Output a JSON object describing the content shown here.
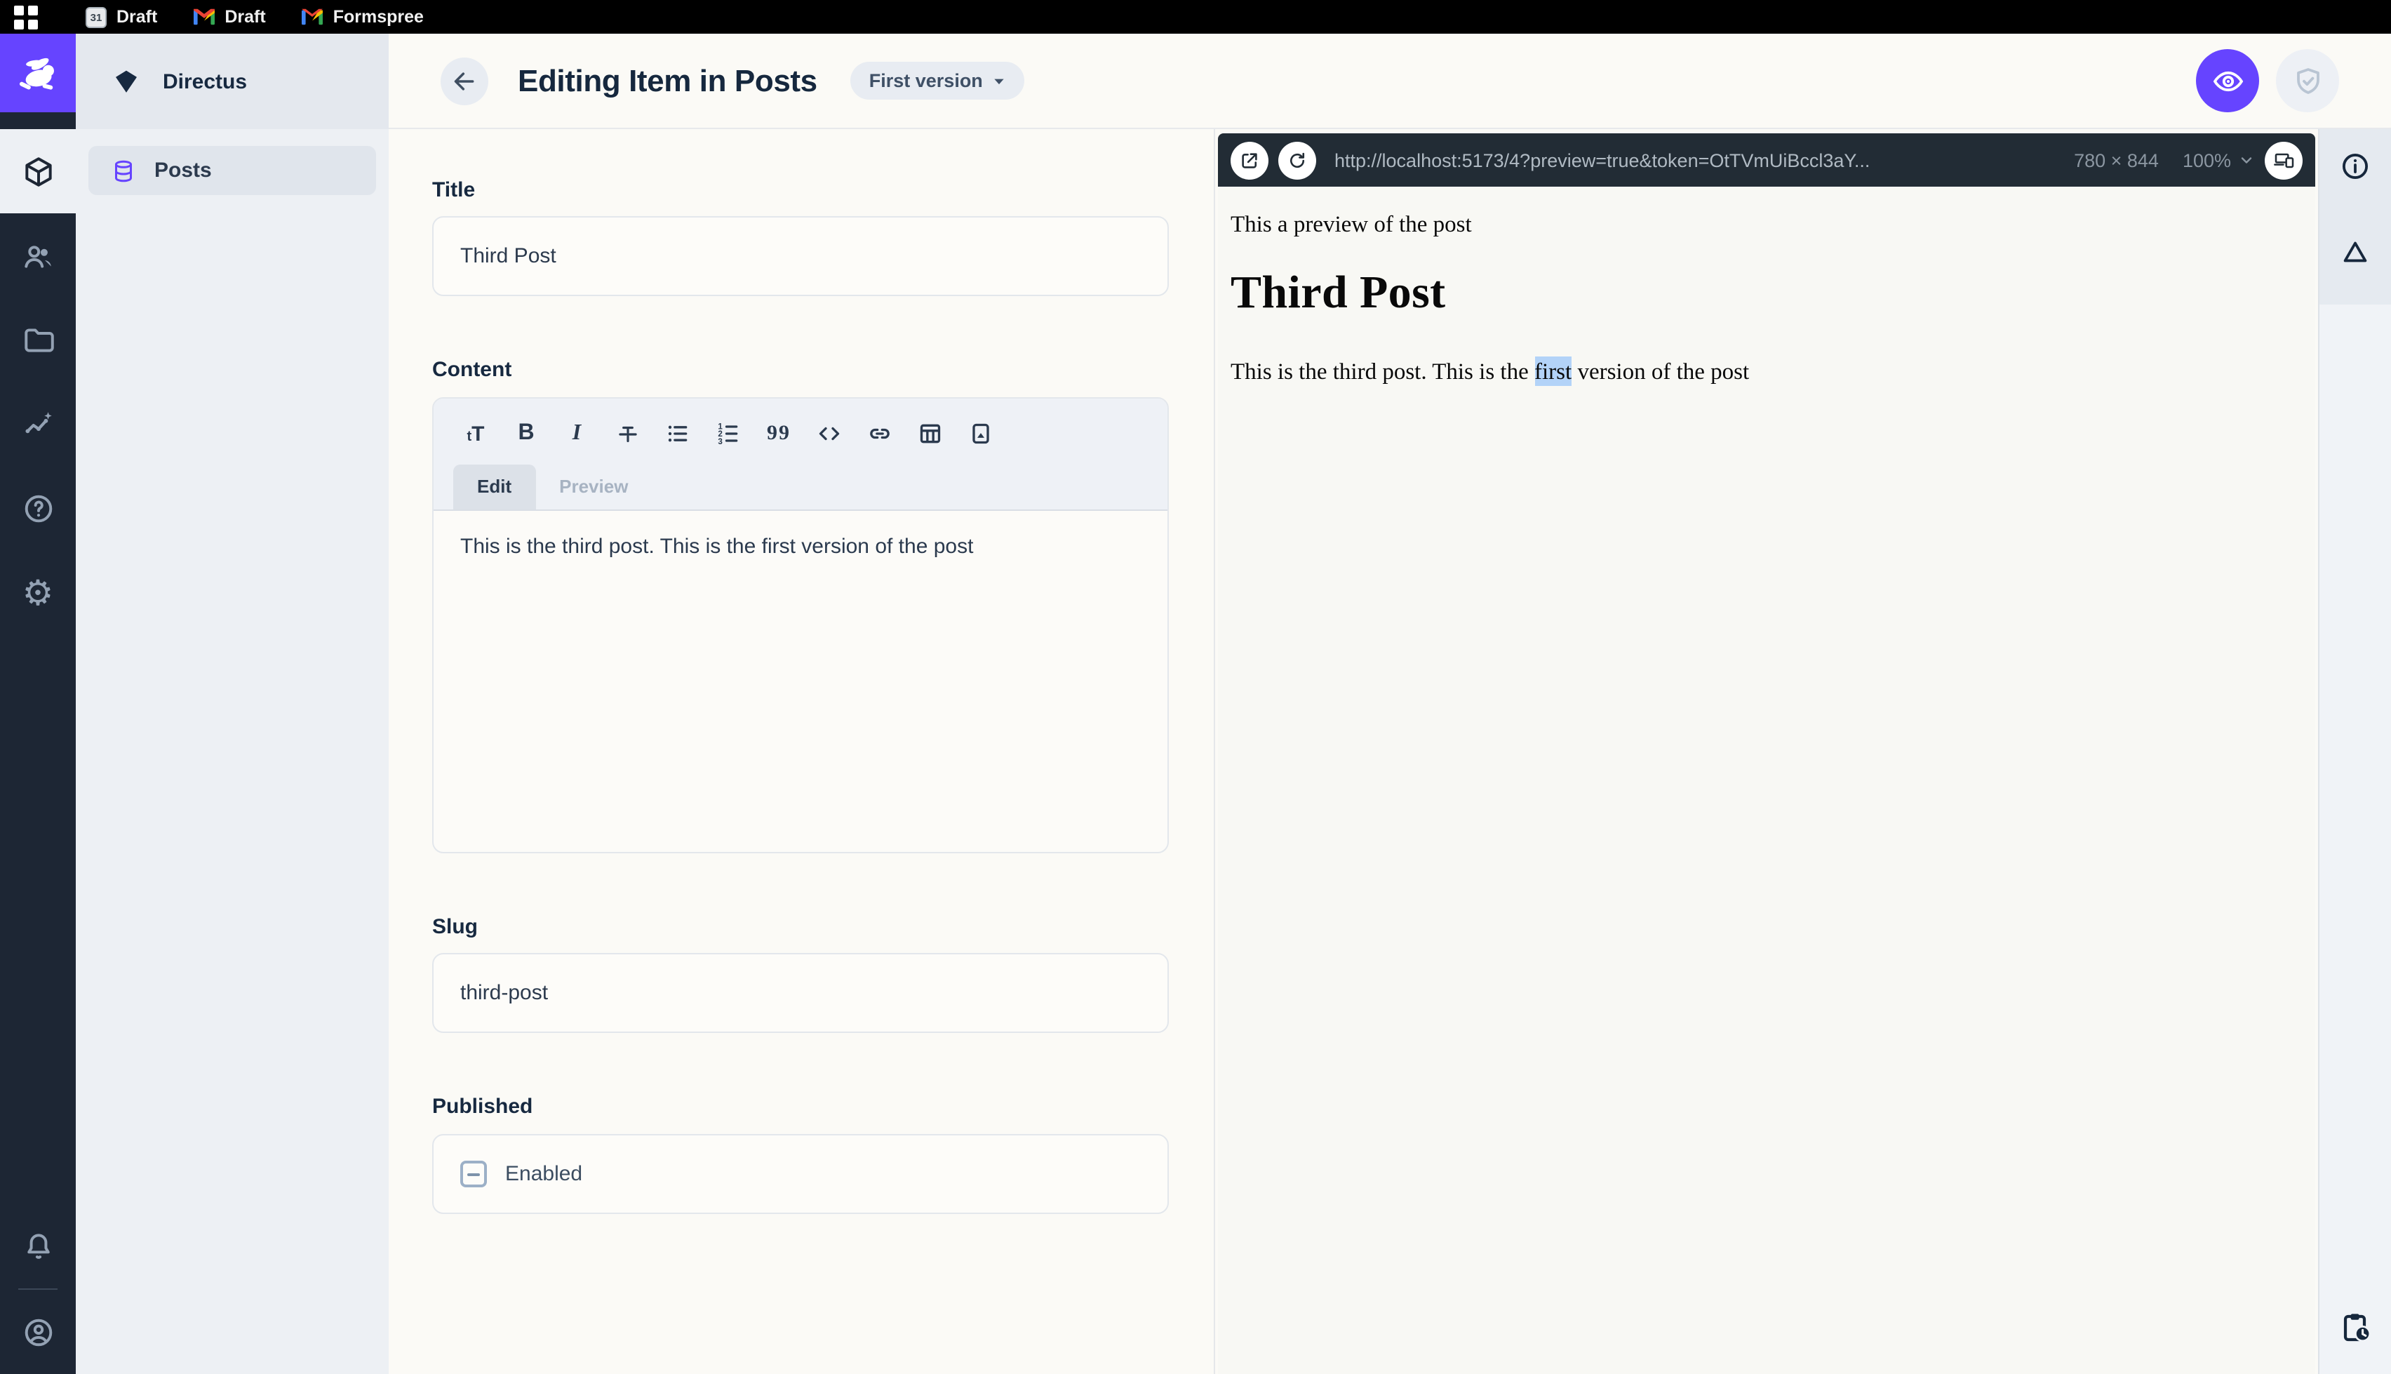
{
  "topbar": {
    "tabs": [
      {
        "icon": "calendar-icon",
        "label": "Draft"
      },
      {
        "icon": "gmail-icon",
        "label": "Draft"
      },
      {
        "icon": "gmail-icon",
        "label": "Formspree"
      }
    ]
  },
  "module_bar": {
    "icons": [
      "directus-rabbit-logo",
      "box-icon",
      "people-icon",
      "folder-icon",
      "insights-icon",
      "help-icon",
      "settings-icon",
      "bell-icon",
      "account-icon"
    ]
  },
  "sidebar": {
    "project_name": "Directus",
    "items": [
      {
        "icon": "database-icon",
        "label": "Posts"
      }
    ]
  },
  "header": {
    "title": "Editing Item in Posts",
    "version_label": "First version",
    "action_icons": [
      "eye-icon",
      "shield-check-icon"
    ]
  },
  "form": {
    "title": {
      "label": "Title",
      "value": "Third Post"
    },
    "content": {
      "label": "Content",
      "toolbar_icons": [
        "heading-icon",
        "bold-icon",
        "italic-icon",
        "strikethrough-icon",
        "bullet-list-icon",
        "numbered-list-icon",
        "blockquote-icon",
        "code-icon",
        "link-icon",
        "table-icon",
        "image-icon"
      ],
      "tabs": [
        {
          "label": "Edit",
          "active": true
        },
        {
          "label": "Preview",
          "active": false
        }
      ],
      "value": "This is the third post. This is the first version of the post"
    },
    "slug": {
      "label": "Slug",
      "value": "third-post"
    },
    "published": {
      "label": "Published",
      "option_label": "Enabled",
      "checkbox_state": "indeterminate"
    }
  },
  "preview": {
    "url": "http://localhost:5173/4?preview=true&token=OtTVmUiBccl3aY...",
    "dimensions": "780 × 844",
    "zoom_level": "100%",
    "toolbar_icons": [
      "open-in-new-icon",
      "refresh-icon",
      "chevron-down-icon",
      "devices-icon"
    ],
    "content": {
      "intro": "This a preview of the post",
      "heading": "Third Post",
      "paragraph_before": "This is the third post. This is the ",
      "paragraph_highlight": "first",
      "paragraph_after": " version of the post"
    }
  },
  "rightbar": {
    "icons": [
      "info-icon",
      "triangle-icon",
      "clipboard-clock-icon"
    ]
  },
  "colors": {
    "accent": "#6644ff",
    "topbar_bg": "#000000",
    "module_bar_bg": "#1d2634",
    "preview_toolbar_bg": "#222c35",
    "selection_highlight": "#b3d3f8"
  }
}
